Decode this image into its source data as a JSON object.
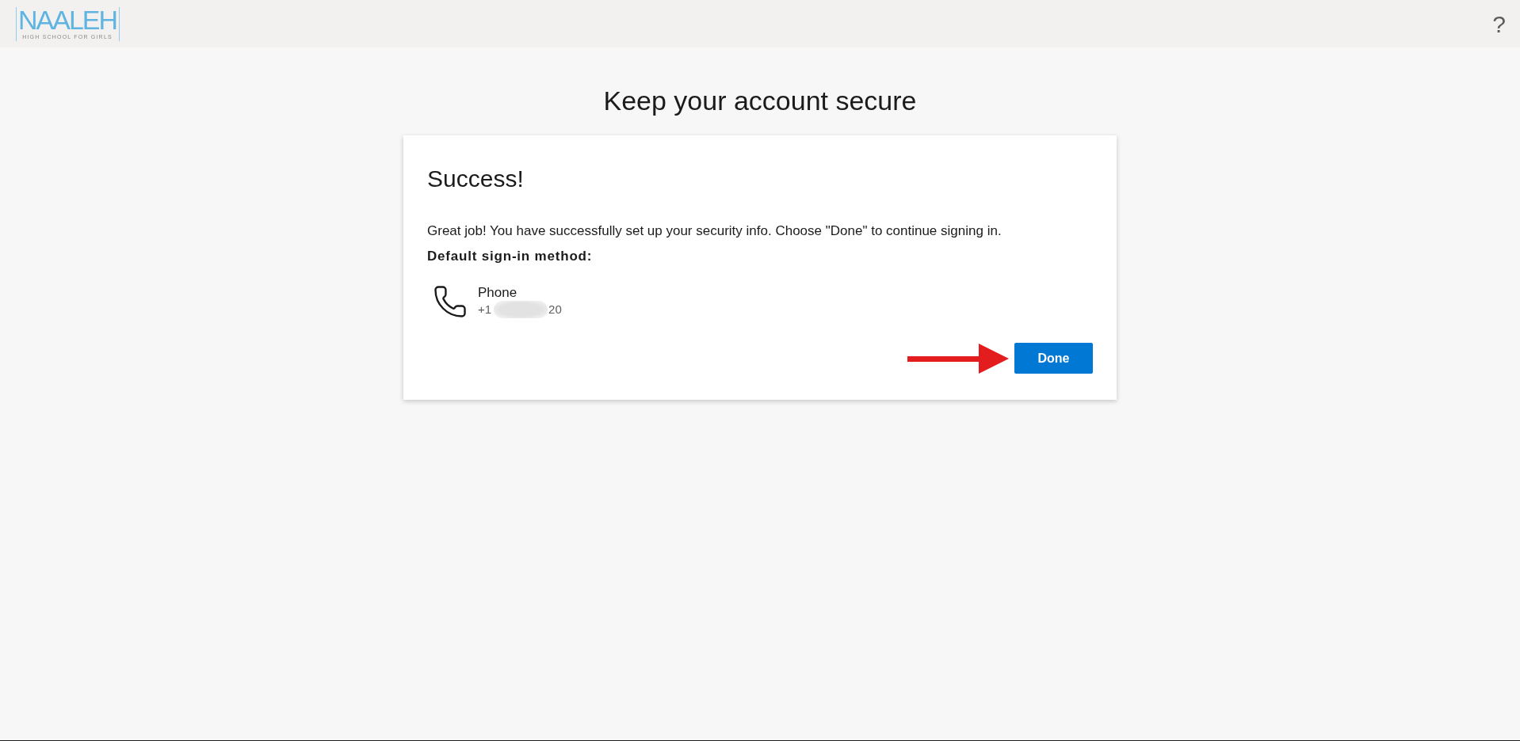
{
  "header": {
    "logo": {
      "wordmark": "NAALEH",
      "tagline": "HIGH SCHOOL FOR GIRLS"
    },
    "help": "?"
  },
  "page": {
    "title": "Keep your account secure"
  },
  "card": {
    "heading": "Success!",
    "message": "Great job! You have successfully set up your security info. Choose \"Done\" to continue signing in.",
    "method_label": "Default sign-in method:",
    "method": {
      "kind": "phone",
      "name": "Phone",
      "number_prefix": "+1",
      "number_suffix": "20",
      "redacted": true
    },
    "annotation_arrow": true,
    "button": "Done"
  }
}
